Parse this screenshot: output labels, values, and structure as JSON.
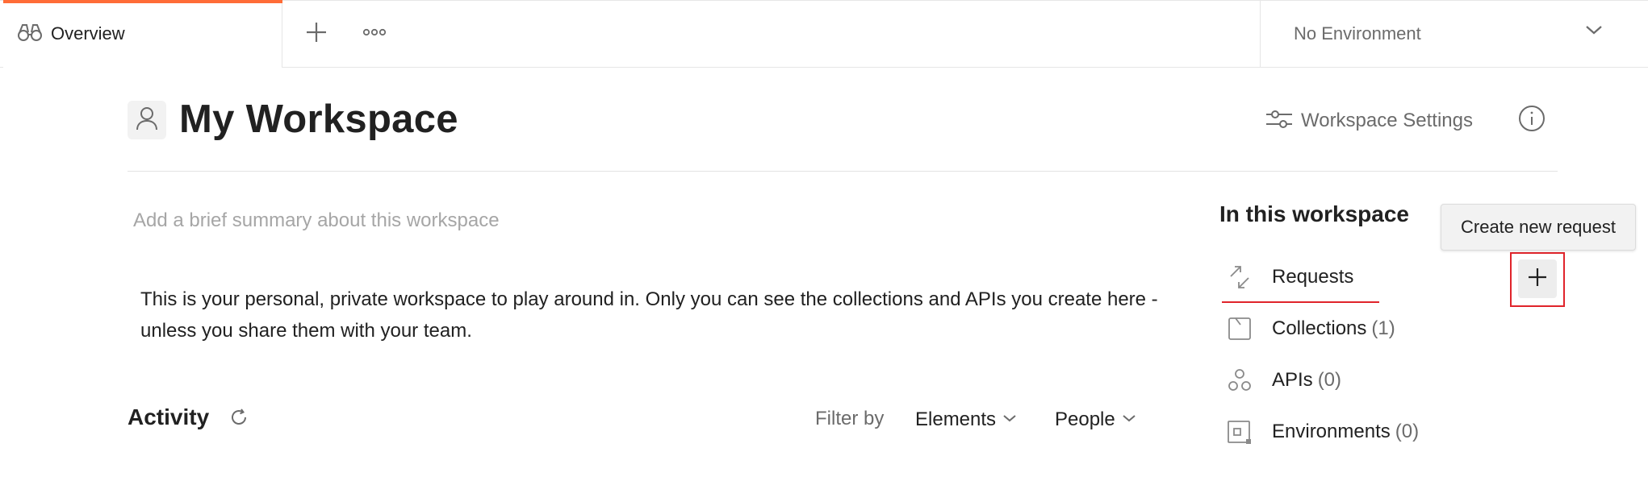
{
  "tabbar": {
    "overview_tab": {
      "label": "Overview",
      "icon": "binoculars-icon"
    },
    "new_tab_icon": "plus-icon",
    "more_tabs_icon": "more-horizontal-icon",
    "environment": {
      "label": "No Environment",
      "icon": "chevron-down-icon"
    },
    "accent_color": "#ff6c37"
  },
  "header": {
    "avatar_icon": "person-icon",
    "title": "My Workspace",
    "settings": {
      "label": "Workspace Settings",
      "icon": "sliders-icon"
    },
    "info_icon": "info-icon"
  },
  "main": {
    "summary_placeholder": "Add a brief summary about this workspace",
    "description": "This is your personal, private workspace to play around in. Only you can see the collections and APIs you create here - unless you share them with your team.",
    "activity": {
      "title": "Activity",
      "refresh_icon": "refresh-icon",
      "filter_label": "Filter by",
      "filters": [
        {
          "label": "Elements",
          "icon": "chevron-down-icon"
        },
        {
          "label": "People",
          "icon": "chevron-down-icon"
        }
      ]
    }
  },
  "panel": {
    "title": "In this workspace",
    "items": [
      {
        "label": "Requests",
        "count": "",
        "icon": "request-icon"
      },
      {
        "label": "Collections",
        "count": "(1)",
        "icon": "collection-icon"
      },
      {
        "label": "APIs",
        "count": "(0)",
        "icon": "api-icon"
      },
      {
        "label": "Environments",
        "count": "(0)",
        "icon": "environment-icon"
      }
    ],
    "add_request_icon": "plus-icon",
    "tooltip": "Create new request",
    "highlight_color": "#e0242b"
  }
}
